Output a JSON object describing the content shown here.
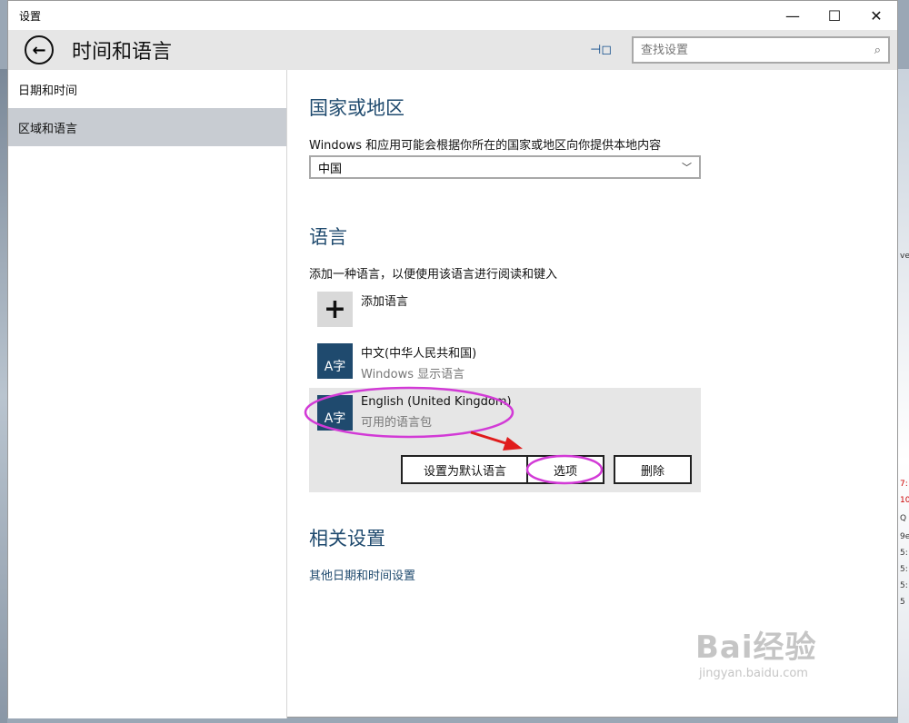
{
  "window": {
    "title": "设置",
    "controls": {
      "minimize": "—",
      "maximize": "☐",
      "close": "✕"
    }
  },
  "header": {
    "page_title": "时间和语言",
    "search_placeholder": "查找设置"
  },
  "sidebar": {
    "items": [
      {
        "label": "日期和时间",
        "active": false
      },
      {
        "label": "区域和语言",
        "active": true
      }
    ]
  },
  "region": {
    "title": "国家或地区",
    "description": "Windows 和应用可能会根据你所在的国家或地区向你提供本地内容",
    "selected": "中国"
  },
  "language": {
    "title": "语言",
    "description": "添加一种语言，以便使用该语言进行阅读和键入",
    "add_label": "添加语言",
    "icon_glyph": "A字",
    "items": [
      {
        "name": "中文(中华人民共和国)",
        "sub": "Windows 显示语言"
      },
      {
        "name": "English (United Kingdom)",
        "sub": "可用的语言包"
      }
    ],
    "buttons": {
      "set_default": "设置为默认语言",
      "options": "选项",
      "remove": "删除"
    }
  },
  "related": {
    "title": "相关设置",
    "link": "其他日期和时间设置"
  },
  "annotation_color": "#d23ad6",
  "arrow_color": "#e01b1b",
  "watermark": {
    "brand": "Bai经验",
    "url": "jingyan.baidu.com"
  },
  "desktop_fragments": [
    "ve",
    "7:",
    "10",
    "Q",
    "9e",
    "5:",
    "5:",
    "5:",
    "5"
  ]
}
